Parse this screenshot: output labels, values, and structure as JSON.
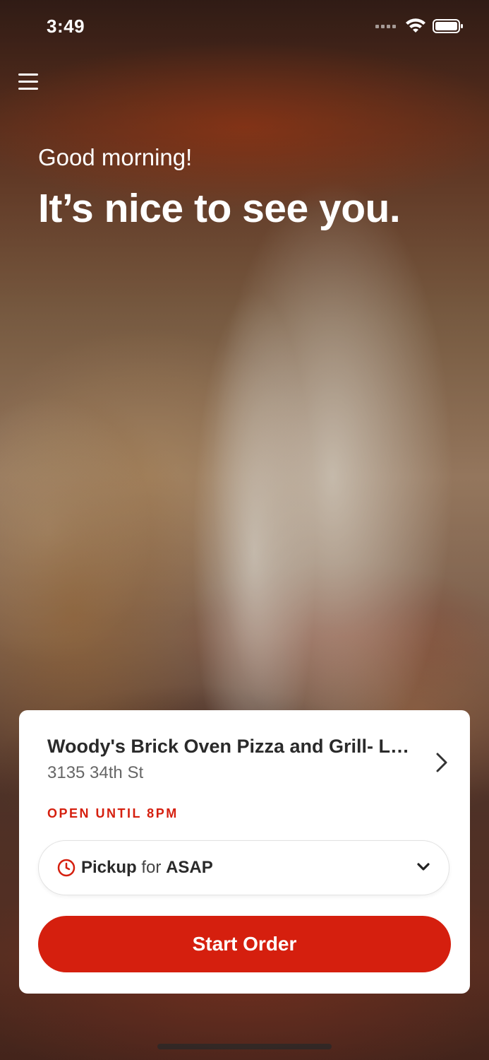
{
  "status_bar": {
    "time": "3:49",
    "icons": [
      "signal-dots-icon",
      "wifi-icon",
      "battery-icon"
    ]
  },
  "header": {
    "menu_icon": "hamburger-menu-icon",
    "greeting": "Good morning!",
    "headline": "It’s nice to see you."
  },
  "store_card": {
    "name": "Woody's Brick Oven Pizza and Grill- Lu...",
    "address": "3135 34th St",
    "open_status": "OPEN UNTIL 8PM",
    "order_mode": {
      "icon": "clock-icon",
      "mode": "Pickup",
      "connector": "for",
      "time": "ASAP"
    },
    "start_button_label": "Start Order"
  },
  "colors": {
    "accent": "#d51f0e",
    "text_dark": "#2a2a2a",
    "text_muted": "#666666",
    "card_background": "#ffffff"
  }
}
